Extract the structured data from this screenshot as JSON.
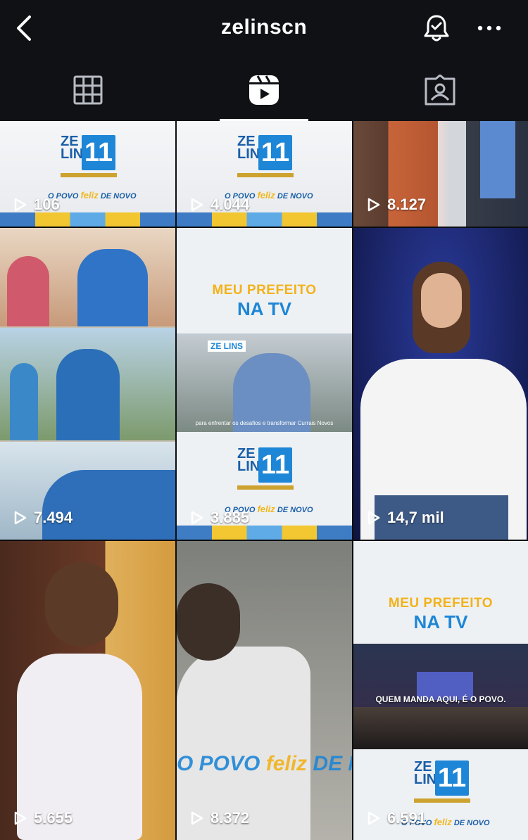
{
  "header": {
    "title": "zelinscn"
  },
  "tabs": [
    {
      "label": "grid",
      "icon": "grid-icon"
    },
    {
      "label": "reels",
      "icon": "reels-icon",
      "active": true
    },
    {
      "label": "tagged",
      "icon": "tagged-icon"
    }
  ],
  "brand": {
    "ze": "ZE",
    "lins": "LINS",
    "number": "11",
    "slogan_pre": "O POVO",
    "slogan_mid": "feliz",
    "slogan_post": "DE NOVO",
    "tv_line1": "MEU PREFEITO",
    "tv_line2": "NA TV",
    "tv_inset_brand": "ZE LINS",
    "tv_inset_caption": "QUEM MANDA AQUI, É O POVO.",
    "tv_small_caption": "para enfrentar os desafios e transformar Currais Novos"
  },
  "reels": [
    {
      "count": "106"
    },
    {
      "count": "4.044"
    },
    {
      "count": "8.127"
    },
    {
      "count": "7.494"
    },
    {
      "count": "3.885"
    },
    {
      "count": "14,7 mil"
    },
    {
      "count": "5.655"
    },
    {
      "count": "8.372"
    },
    {
      "count": "6.591"
    }
  ],
  "colors": {
    "background": "#0b0d10",
    "brand_blue": "#1e86d6",
    "brand_yellow": "#f2b21b"
  }
}
